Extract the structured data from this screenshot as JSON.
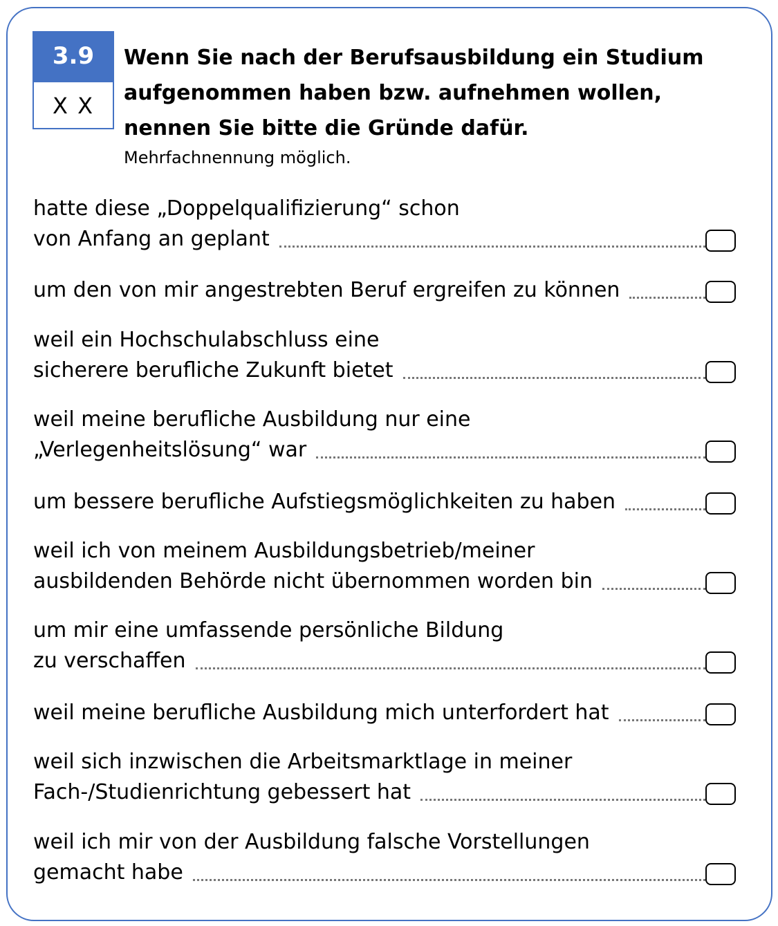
{
  "question": {
    "number": "3.9",
    "code": "X X",
    "title": "Wenn Sie nach der Berufsausbildung ein Studium aufgenommen haben bzw. aufnehmen wollen, nennen Sie bitte die Gründe dafür.",
    "title_lines": [
      "Wenn Sie nach der Berufsausbildung ein Studium",
      "aufgenommen haben bzw. aufnehmen wollen,",
      "nennen Sie bitte die Gründe dafür."
    ],
    "instruction": "Mehrfachnennung möglich."
  },
  "options": [
    {
      "lines": [
        "hatte diese „Doppelqualifizierung“ schon",
        "von Anfang an geplant"
      ],
      "checked": false
    },
    {
      "lines": [
        "um den von mir angestrebten Beruf ergreifen zu können"
      ],
      "checked": false
    },
    {
      "lines": [
        "weil ein Hochschulabschluss eine",
        "sicherere berufliche Zukunft bietet"
      ],
      "checked": false
    },
    {
      "lines": [
        "weil meine berufliche Ausbildung nur eine",
        "„Verlegenheitslösung“ war"
      ],
      "checked": false
    },
    {
      "lines": [
        "um bessere berufliche Aufstiegsmöglichkeiten zu haben"
      ],
      "checked": false
    },
    {
      "lines": [
        "weil ich von meinem Ausbildungsbetrieb/meiner",
        "ausbildenden Behörde nicht übernommen worden bin"
      ],
      "checked": false
    },
    {
      "lines": [
        "um mir eine umfassende persönliche Bildung",
        "zu verschaffen"
      ],
      "checked": false
    },
    {
      "lines": [
        "weil meine berufliche Ausbildung mich unterfordert hat"
      ],
      "checked": false
    },
    {
      "lines": [
        "weil sich inzwischen die Arbeitsmarktlage in meiner",
        "Fach-/Studienrichtung gebessert hat"
      ],
      "checked": false
    },
    {
      "lines": [
        "weil ich mir von der Ausbildung falsche Vorstellungen",
        "gemacht habe"
      ],
      "checked": false
    }
  ]
}
